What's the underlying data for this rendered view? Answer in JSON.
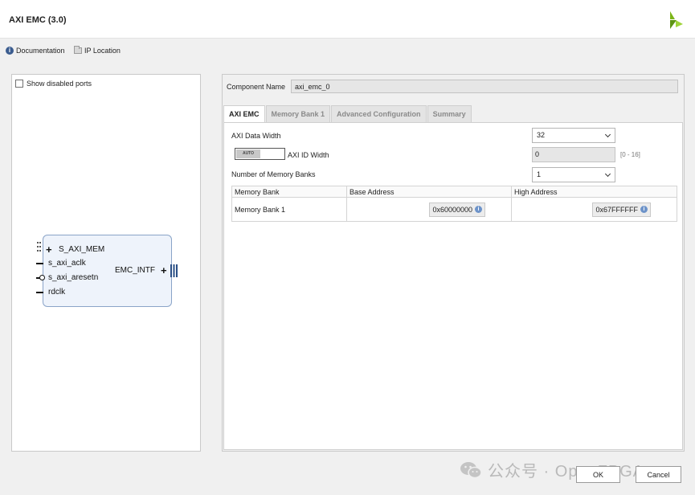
{
  "window": {
    "title": "AXI EMC (3.0)"
  },
  "links": {
    "documentation": "Documentation",
    "ip_location": "IP Location"
  },
  "left_panel": {
    "show_disabled_ports_label": "Show disabled ports",
    "block": {
      "ports_left": [
        "S_AXI_MEM",
        "s_axi_aclk",
        "s_axi_aresetn",
        "rdclk"
      ],
      "port_right": "EMC_INTF"
    }
  },
  "component": {
    "label": "Component Name",
    "value": "axi_emc_0"
  },
  "tabs": [
    {
      "label": "AXI EMC",
      "active": true
    },
    {
      "label": "Memory Bank 1",
      "active": false
    },
    {
      "label": "Advanced Configuration",
      "active": false
    },
    {
      "label": "Summary",
      "active": false
    }
  ],
  "axi_emc": {
    "data_width_label": "AXI Data Width",
    "data_width_value": "32",
    "id_width_toggle": "AUTO",
    "id_width_label": "AXI ID Width",
    "id_width_value": "0",
    "id_width_range": "[0 - 16]",
    "num_banks_label": "Number of Memory Banks",
    "num_banks_value": "1"
  },
  "memory_table": {
    "headers": [
      "Memory Bank",
      "Base Address",
      "High Address"
    ],
    "rows": [
      {
        "bank": "Memory Bank 1",
        "base": "0x60000000",
        "high": "0x67FFFFFF"
      }
    ]
  },
  "watermark": "公众号 · OpenFPGA",
  "buttons": {
    "ok": "OK",
    "cancel": "Cancel"
  },
  "colors": {
    "accent": "#3b5c8f",
    "logo_green": "#7cb518",
    "block_border": "#8aa4c8"
  }
}
